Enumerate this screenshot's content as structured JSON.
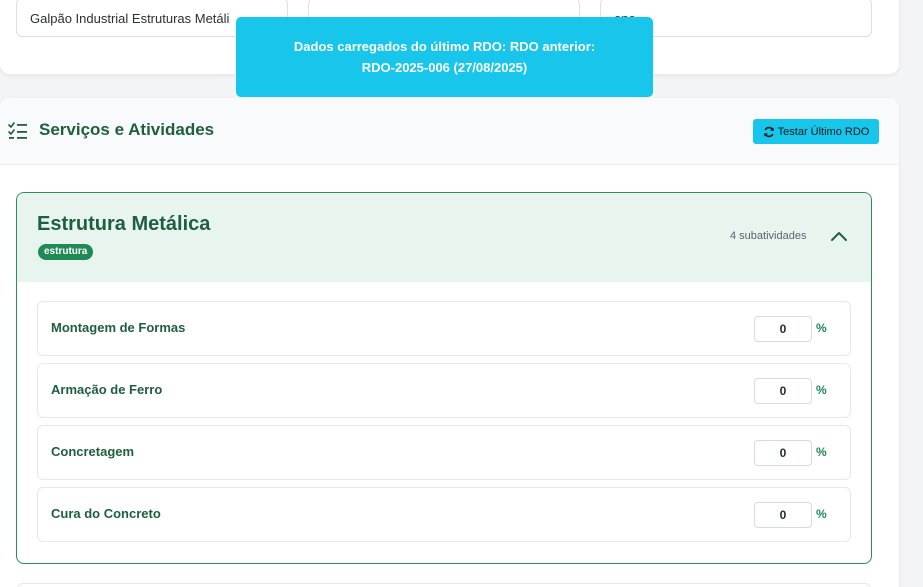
{
  "top_fields": [
    {
      "value": "Galpão Industrial Estruturas Metáli"
    },
    {
      "value": ""
    },
    {
      "value": "one"
    }
  ],
  "toast": {
    "message": "Dados carregados do último RDO: RDO anterior: RDO-2025-006 (27/08/2025)"
  },
  "section": {
    "title": "Serviços e Atividades",
    "icon": "list-check-icon",
    "test_button_label": "Testar Último RDO",
    "test_button_icon": "refresh-icon"
  },
  "activity": {
    "title": "Estrutura Metálica",
    "tag": "estrutura",
    "sub_count": "4 subatividades",
    "collapse_icon": "chevron-up-icon",
    "subactivities": [
      {
        "name": "Montagem de Formas",
        "value": "0",
        "unit": "%"
      },
      {
        "name": "Armação de Ferro",
        "value": "0",
        "unit": "%"
      },
      {
        "name": "Concretagem",
        "value": "0",
        "unit": "%"
      },
      {
        "name": "Cura do Concreto",
        "value": "0",
        "unit": "%"
      }
    ]
  },
  "colors": {
    "accent": "#17c6ea",
    "green_dark": "#1e5f3f",
    "green": "#1f8a55"
  }
}
